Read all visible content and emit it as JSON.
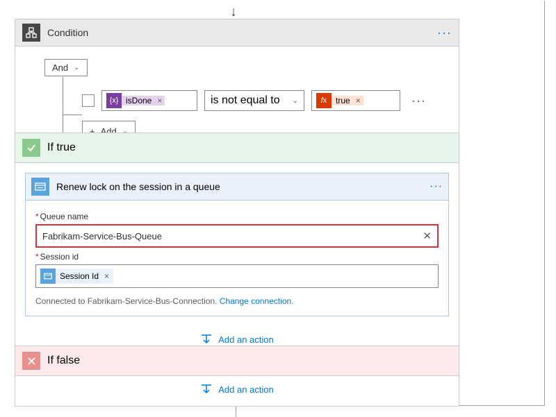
{
  "condition": {
    "title": "Condition",
    "join": "And",
    "add": "Add",
    "left_token": "isDone",
    "operator": "is not equal to",
    "right_token": "true"
  },
  "iftrue": {
    "title": "If true",
    "renew": {
      "title": "Renew lock on the session in a queue",
      "queue_label": "Queue name",
      "queue_value": "Fabrikam-Service-Bus-Queue",
      "session_label": "Session id",
      "session_token": "Session Id",
      "connected_prefix": "Connected to Fabrikam-Service-Bus-Connection. ",
      "change_link": "Change connection."
    },
    "add_action": "Add an action"
  },
  "iffalse": {
    "title": "If false",
    "add_action": "Add an action"
  }
}
